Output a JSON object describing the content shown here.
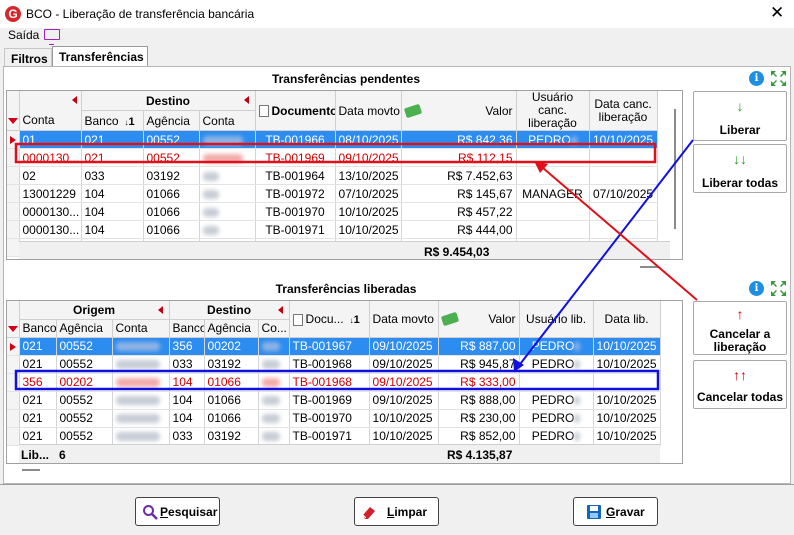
{
  "window": {
    "title": "BCO - Liberação de transferência bancária",
    "logo_letter": "G"
  },
  "menu": {
    "saida": "Saída"
  },
  "tabs": [
    "Filtros",
    "Transferências"
  ],
  "pendentes": {
    "title": "Transferências pendentes",
    "group_destino": "Destino",
    "headers": {
      "conta": "Conta",
      "banco": "Banco",
      "sort_num": "1",
      "agencia": "Agência",
      "conta2": "Conta",
      "documento": "Documento",
      "data_movto": "Data movto",
      "valor": "Valor",
      "usuario": "Usuário canc. liberação",
      "data_canc": "Data canc. liberação"
    },
    "rows": [
      {
        "conta": "01",
        "banco": "021",
        "agencia": "00552",
        "documento": "TB-001966",
        "data": "08/10/2025",
        "valor": "R$ 842,36",
        "usuario": "PEDRO",
        "data_canc": "10/10/2025"
      },
      {
        "conta": "0000130...",
        "banco": "021",
        "agencia": "00552",
        "documento": "TB-001969",
        "data": "09/10/2025",
        "valor": "R$ 112,15",
        "usuario": "",
        "data_canc": ""
      },
      {
        "conta": "02",
        "banco": "033",
        "agencia": "03192",
        "documento": "TB-001964",
        "data": "13/10/2025",
        "valor": "R$ 7.452,63",
        "usuario": "",
        "data_canc": ""
      },
      {
        "conta": "13001229",
        "banco": "104",
        "agencia": "01066",
        "documento": "TB-001972",
        "data": "07/10/2025",
        "valor": "R$ 145,67",
        "usuario": "MANAGER",
        "data_canc": "07/10/2025"
      },
      {
        "conta": "0000130...",
        "banco": "104",
        "agencia": "01066",
        "documento": "TB-001970",
        "data": "10/10/2025",
        "valor": "R$ 457,22",
        "usuario": "",
        "data_canc": ""
      },
      {
        "conta": "0000130...",
        "banco": "104",
        "agencia": "01066",
        "documento": "TB-001971",
        "data": "10/10/2025",
        "valor": "R$ 444,00",
        "usuario": "",
        "data_canc": ""
      }
    ],
    "total": "R$ 9.454,03"
  },
  "liberadas": {
    "title": "Transferências liberadas",
    "group_origem": "Origem",
    "group_destino": "Destino",
    "headers": {
      "banco": "Banco",
      "agencia": "Agência",
      "conta": "Conta",
      "banco2": "Banco",
      "agencia2": "Agência",
      "conta2": "Co...",
      "documento": "Docu...",
      "sort_num": "1",
      "data_movto": "Data movto",
      "valor": "Valor",
      "usuario": "Usuário lib.",
      "data_lib": "Data lib."
    },
    "rows": [
      {
        "banco": "021",
        "agencia": "00552",
        "banco2": "356",
        "agencia2": "00202",
        "documento": "TB-001967",
        "data": "09/10/2025",
        "valor": "R$ 887,00",
        "usuario": "PEDRO",
        "data_lib": "10/10/2025"
      },
      {
        "banco": "021",
        "agencia": "00552",
        "banco2": "033",
        "agencia2": "03192",
        "documento": "TB-001968",
        "data": "09/10/2025",
        "valor": "R$ 945,87",
        "usuario": "PEDRO",
        "data_lib": "10/10/2025"
      },
      {
        "banco": "356",
        "agencia": "00202",
        "banco2": "104",
        "agencia2": "01066",
        "documento": "TB-001968",
        "data": "09/10/2025",
        "valor": "R$ 333,00",
        "usuario": "",
        "data_lib": ""
      },
      {
        "banco": "021",
        "agencia": "00552",
        "banco2": "104",
        "agencia2": "01066",
        "documento": "TB-001969",
        "data": "09/10/2025",
        "valor": "R$ 888,00",
        "usuario": "PEDRO",
        "data_lib": "10/10/2025"
      },
      {
        "banco": "021",
        "agencia": "00552",
        "banco2": "104",
        "agencia2": "01066",
        "documento": "TB-001970",
        "data": "10/10/2025",
        "valor": "R$ 230,00",
        "usuario": "PEDRO",
        "data_lib": "10/10/2025"
      },
      {
        "banco": "021",
        "agencia": "00552",
        "banco2": "033",
        "agencia2": "03192",
        "documento": "TB-001971",
        "data": "10/10/2025",
        "valor": "R$ 852,00",
        "usuario": "PEDRO",
        "data_lib": "10/10/2025"
      }
    ],
    "footer_label": "Lib...",
    "footer_count": "6",
    "total": "R$ 4.135,87"
  },
  "side_buttons": {
    "liberar": "Liberar",
    "liberar_todas": "Liberar todas",
    "cancelar_liberacao_1": "Cancelar a",
    "cancelar_liberacao_2": "liberação",
    "cancelar_todas": "Cancelar todas"
  },
  "bottom_buttons": {
    "pesquisar_first": "P",
    "pesquisar_rest": "esquisar",
    "limpar_first": "L",
    "limpar_rest": "impar",
    "gravar_first": "G",
    "gravar_rest": "ravar"
  },
  "colors": {
    "selection": "#2d8cf0",
    "highlight_red": "#e0101a",
    "highlight_blue": "#1010e0",
    "cancel_arrow": "#d0000f",
    "liberar_arrow": "#2aa02a"
  },
  "icons": {
    "app": "app-logo-icon",
    "monitor": "monitor-icon",
    "info": "info-icon",
    "expand": "expand-icon",
    "search": "search-icon",
    "eraser": "eraser-icon",
    "save": "save-icon"
  }
}
